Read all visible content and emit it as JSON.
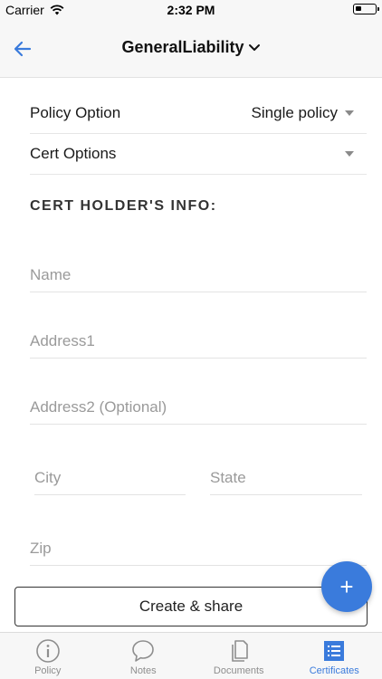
{
  "status_bar": {
    "carrier": "Carrier",
    "time": "2:32 PM"
  },
  "nav": {
    "title": "GeneralLiability",
    "back_icon": "arrow-left-icon",
    "title_icon": "chevron-down-icon"
  },
  "form": {
    "policy_option": {
      "label": "Policy Option",
      "value": "Single policy"
    },
    "cert_options": {
      "label": "Cert Options",
      "value": ""
    },
    "section_heading": "CERT HOLDER'S INFO:",
    "fields": {
      "name": {
        "placeholder": "Name",
        "value": ""
      },
      "address1": {
        "placeholder": "Address1",
        "value": ""
      },
      "address2": {
        "placeholder": "Address2 (Optional)",
        "value": ""
      },
      "city": {
        "placeholder": "City",
        "value": ""
      },
      "state": {
        "placeholder": "State",
        "value": ""
      },
      "zip": {
        "placeholder": "Zip",
        "value": ""
      }
    },
    "create_button": "Create & share"
  },
  "fab": {
    "label": "+"
  },
  "tabs": [
    {
      "label": "Policy",
      "icon": "info-icon",
      "active": false
    },
    {
      "label": "Notes",
      "icon": "chat-bubble-icon",
      "active": false
    },
    {
      "label": "Documents",
      "icon": "documents-icon",
      "active": false
    },
    {
      "label": "Certificates",
      "icon": "list-icon",
      "active": true
    }
  ],
  "colors": {
    "accent": "#3a7bdc",
    "inactive": "#8e8e8e",
    "bar_background": "#f7f7f7"
  }
}
